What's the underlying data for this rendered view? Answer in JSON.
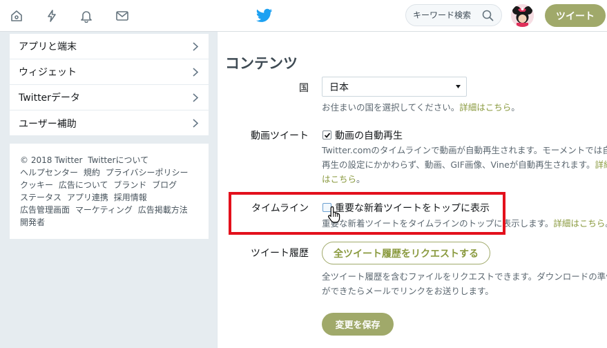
{
  "topbar": {
    "search_placeholder": "キーワード検索",
    "tweet_button": "ツイート"
  },
  "menu": {
    "items": [
      {
        "label": "アプリと端末"
      },
      {
        "label": "ウィジェット"
      },
      {
        "label": "Twitterデータ"
      },
      {
        "label": "ユーザー補助"
      }
    ]
  },
  "footer": {
    "links": [
      "© 2018 Twitter",
      "Twitterについて",
      "ヘルプセンター",
      "規約",
      "プライバシーポリシー",
      "クッキー",
      "広告について",
      "ブランド",
      "ブログ",
      "ステータス",
      "アプリ連携",
      "採用情報",
      "広告管理画面",
      "マーケティング",
      "広告掲載方法",
      "開発者"
    ]
  },
  "content": {
    "title": "コンテンツ",
    "country": {
      "label": "国",
      "value": "日本",
      "help": "お住まいの国を選択してください。",
      "help_link": "詳細はこちら"
    },
    "video": {
      "label": "動画ツイート",
      "checkbox_label": "動画の自動再生",
      "checked": true,
      "help_line1": "Twitter.comのタイムラインで動画が自動再生されます。モーメントでは自動",
      "help_line2": "再生の設定にかかわらず、動画、GIF画像、Vineが自動再生されます。",
      "help_link_a": "詳細",
      "help_link_b": "はこちら"
    },
    "timeline": {
      "label": "タイムライン",
      "checkbox_label": "重要な新着ツイートをトップに表示",
      "checked": false,
      "help": "重要な新着ツイートをタイムラインのトップに表示します。",
      "help_link": "詳細はこちら"
    },
    "history": {
      "label": "ツイート履歴",
      "button": "全ツイート履歴をリクエストする",
      "help_line1": "全ツイート履歴を含むファイルをリクエストできます。ダウンロードの準備",
      "help_line2": "ができたらメールでリンクをお送りします。"
    },
    "save_button": "変更を保存"
  },
  "colors": {
    "accent": "#a0a96a",
    "link": "#8a9a3f",
    "highlight": "#e3101c"
  }
}
